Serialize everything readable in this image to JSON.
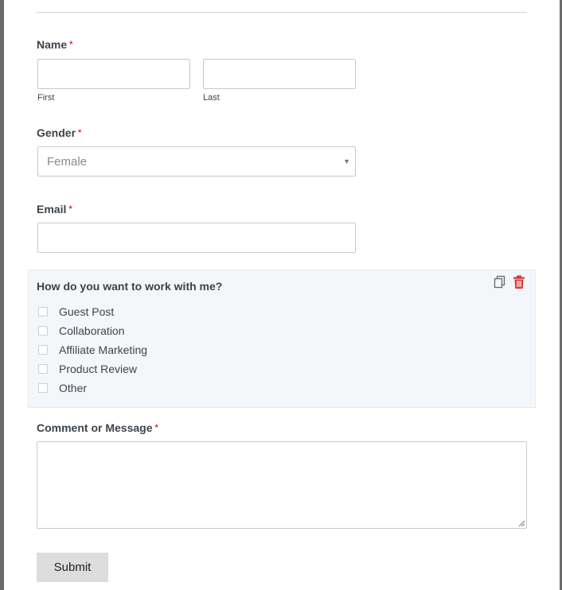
{
  "form": {
    "name": {
      "label": "Name",
      "required_mark": "*",
      "first_sublabel": "First",
      "last_sublabel": "Last"
    },
    "gender": {
      "label": "Gender",
      "required_mark": "*",
      "selected": "Female"
    },
    "email": {
      "label": "Email",
      "required_mark": "*"
    },
    "work_with": {
      "question": "How do you want to work with me?",
      "options": [
        {
          "label": "Guest Post",
          "checked": false
        },
        {
          "label": "Collaboration",
          "checked": false
        },
        {
          "label": "Affiliate Marketing",
          "checked": false
        },
        {
          "label": "Product Review",
          "checked": false
        },
        {
          "label": "Other",
          "checked": false
        }
      ],
      "duplicate_icon": "duplicate-icon",
      "delete_icon": "trash-icon"
    },
    "message": {
      "label": "Comment or Message",
      "required_mark": "*"
    },
    "submit_label": "Submit"
  },
  "colors": {
    "required": "#d63638",
    "delete_icon": "#d63638",
    "active_field_bg": "#f4f7fa",
    "submit_bg": "#dddddd"
  }
}
